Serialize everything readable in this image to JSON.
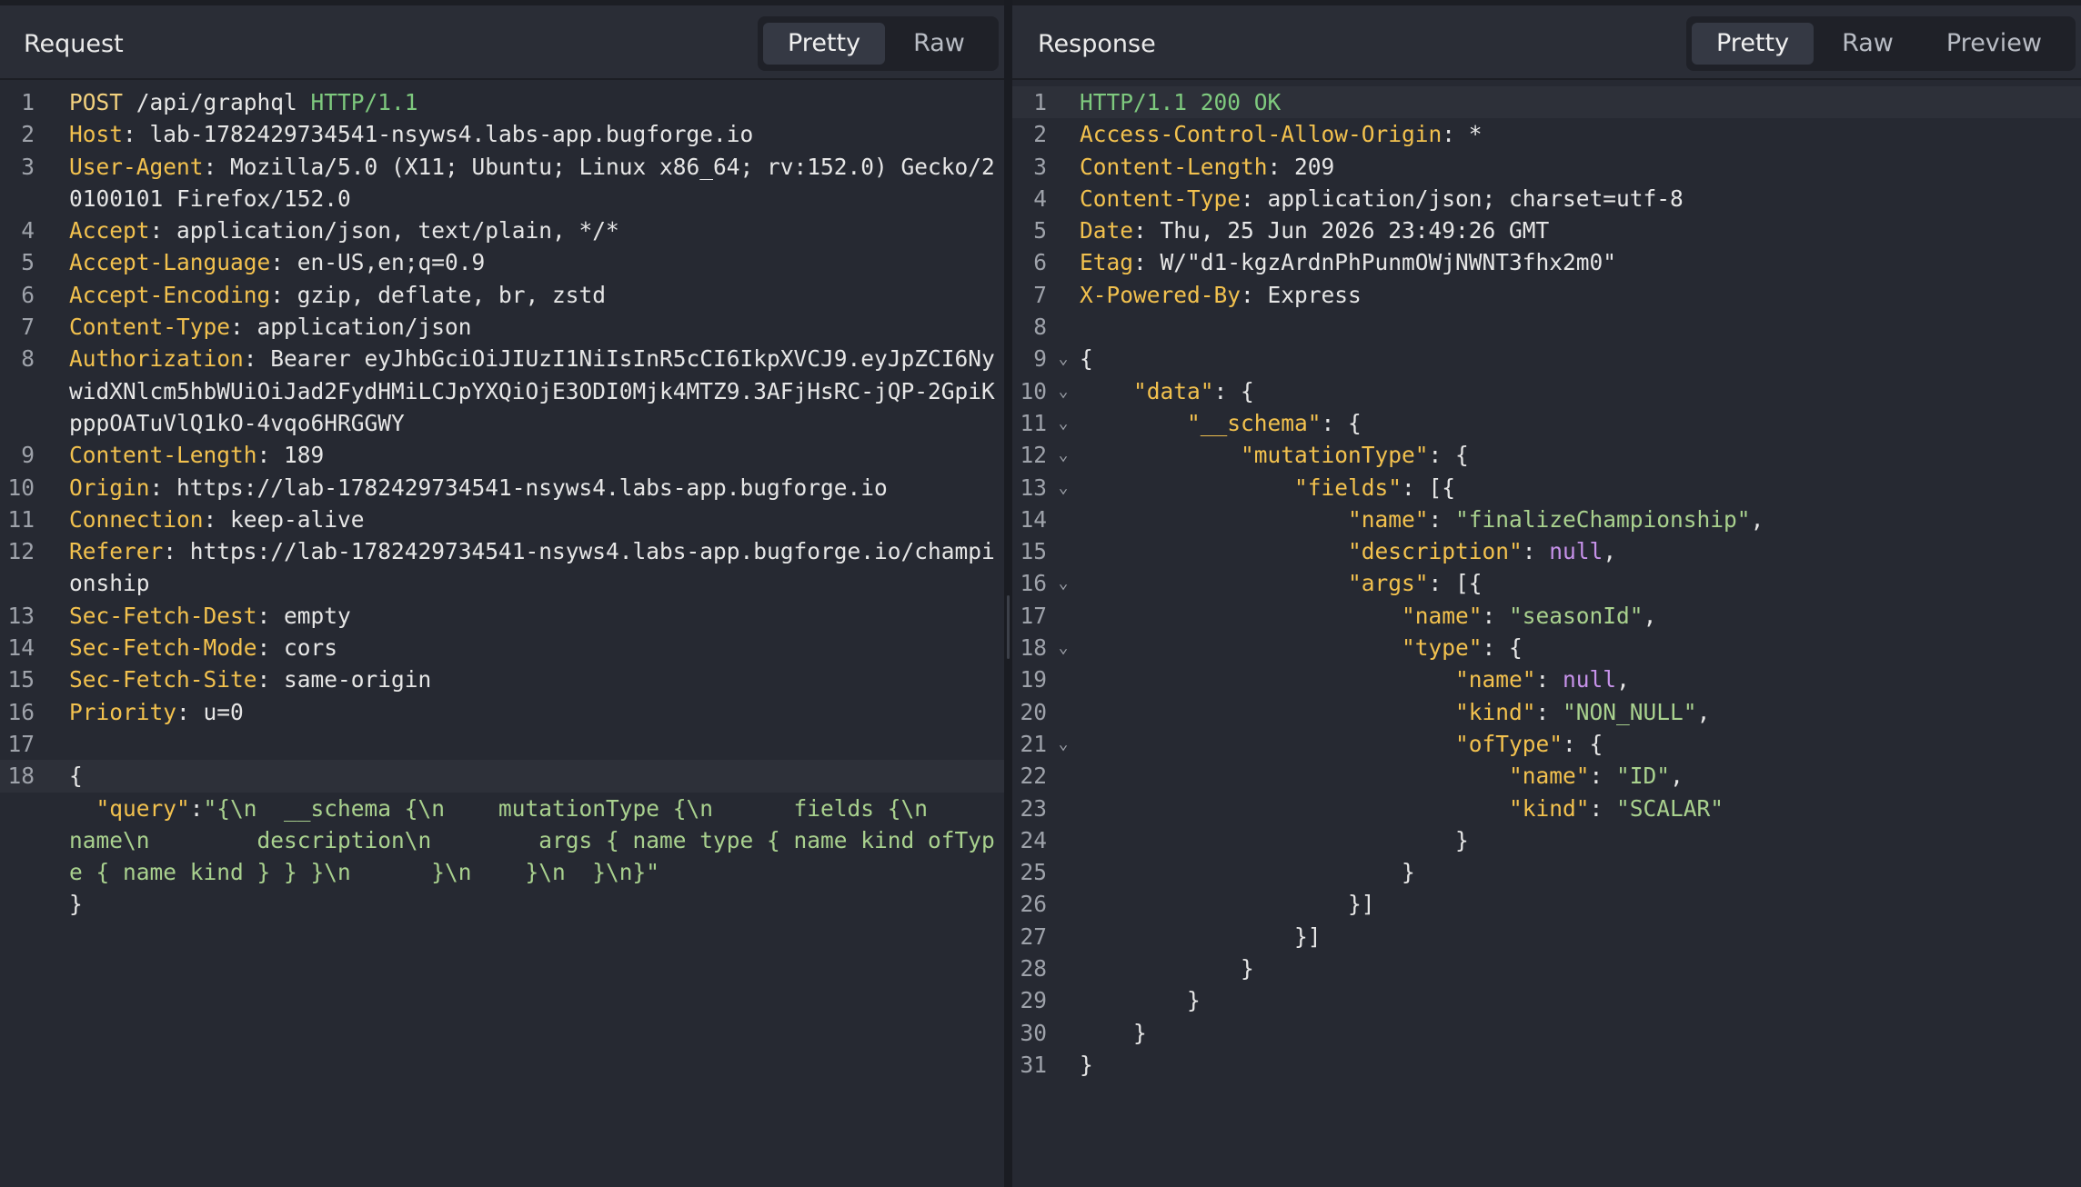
{
  "request": {
    "title": "Request",
    "tabs": [
      {
        "label": "Pretty",
        "active": true
      },
      {
        "label": "Raw",
        "active": false
      }
    ],
    "lines": [
      {
        "n": "1",
        "parts": [
          {
            "t": "POST",
            "c": "method"
          },
          {
            "t": " /api/graphql ",
            "c": "plain"
          },
          {
            "t": "HTTP/1.1",
            "c": "proto"
          }
        ]
      },
      {
        "n": "2",
        "parts": [
          {
            "t": "Host",
            "c": "hname"
          },
          {
            "t": ": lab-1782429734541-nsyws4.labs-app.bugforge.io",
            "c": "plain"
          }
        ]
      },
      {
        "n": "3",
        "parts": [
          {
            "t": "User-Agent",
            "c": "hname"
          },
          {
            "t": ": Mozilla/5.0 (X11; Ubuntu; Linux x86_64; rv:152.0) Gecko/20100101 Firefox/152.0",
            "c": "plain"
          }
        ]
      },
      {
        "n": "4",
        "parts": [
          {
            "t": "Accept",
            "c": "hname"
          },
          {
            "t": ": application/json, text/plain, */*",
            "c": "plain"
          }
        ]
      },
      {
        "n": "5",
        "parts": [
          {
            "t": "Accept-Language",
            "c": "hname"
          },
          {
            "t": ": en-US,en;q=0.9",
            "c": "plain"
          }
        ]
      },
      {
        "n": "6",
        "parts": [
          {
            "t": "Accept-Encoding",
            "c": "hname"
          },
          {
            "t": ": gzip, deflate, br, zstd",
            "c": "plain"
          }
        ]
      },
      {
        "n": "7",
        "parts": [
          {
            "t": "Content-Type",
            "c": "hname"
          },
          {
            "t": ": application/json",
            "c": "plain"
          }
        ]
      },
      {
        "n": "8",
        "parts": [
          {
            "t": "Authorization",
            "c": "hname"
          },
          {
            "t": ": Bearer eyJhbGciOiJIUzI1NiIsInR5cCI6IkpXVCJ9.eyJpZCI6NywidXNlcm5hbWUiOiJad2FydHMiLCJpYXQiOjE3ODI0Mjk4MTZ9.3AFjHsRC-jQP-2GpiKpppOATuVlQ1kO-4vqo6HRGGWY",
            "c": "plain"
          }
        ]
      },
      {
        "n": "9",
        "parts": [
          {
            "t": "Content-Length",
            "c": "hname"
          },
          {
            "t": ": 189",
            "c": "plain"
          }
        ]
      },
      {
        "n": "10",
        "parts": [
          {
            "t": "Origin",
            "c": "hname"
          },
          {
            "t": ": https://lab-1782429734541-nsyws4.labs-app.bugforge.io",
            "c": "plain"
          }
        ]
      },
      {
        "n": "11",
        "parts": [
          {
            "t": "Connection",
            "c": "hname"
          },
          {
            "t": ": keep-alive",
            "c": "plain"
          }
        ]
      },
      {
        "n": "12",
        "parts": [
          {
            "t": "Referer",
            "c": "hname"
          },
          {
            "t": ": https://lab-1782429734541-nsyws4.labs-app.bugforge.io/championship",
            "c": "plain"
          }
        ]
      },
      {
        "n": "13",
        "parts": [
          {
            "t": "Sec-Fetch-Dest",
            "c": "hname"
          },
          {
            "t": ": empty",
            "c": "plain"
          }
        ]
      },
      {
        "n": "14",
        "parts": [
          {
            "t": "Sec-Fetch-Mode",
            "c": "hname"
          },
          {
            "t": ": cors",
            "c": "plain"
          }
        ]
      },
      {
        "n": "15",
        "parts": [
          {
            "t": "Sec-Fetch-Site",
            "c": "hname"
          },
          {
            "t": ": same-origin",
            "c": "plain"
          }
        ]
      },
      {
        "n": "16",
        "parts": [
          {
            "t": "Priority",
            "c": "hname"
          },
          {
            "t": ": u=0",
            "c": "plain"
          }
        ]
      },
      {
        "n": "17",
        "parts": []
      },
      {
        "n": "18",
        "hl": true,
        "parts": [
          {
            "t": "{",
            "c": "plain"
          }
        ]
      },
      {
        "n": "",
        "parts": [
          {
            "t": "  ",
            "c": "plain"
          },
          {
            "t": "\"query\"",
            "c": "jkey"
          },
          {
            "t": ":",
            "c": "plain"
          },
          {
            "t": "\"{\\n  __schema {\\n    mutationType {\\n      fields {\\n        name\\n        description\\n        args { name type { name kind ofType { name kind } } }\\n      }\\n    }\\n  }\\n}\"",
            "c": "jstr"
          }
        ]
      },
      {
        "n": "",
        "parts": [
          {
            "t": "}",
            "c": "plain"
          }
        ]
      }
    ]
  },
  "response": {
    "title": "Response",
    "tabs": [
      {
        "label": "Pretty",
        "active": true
      },
      {
        "label": "Raw",
        "active": false
      },
      {
        "label": "Preview",
        "active": false
      }
    ],
    "lines": [
      {
        "n": "1",
        "hl": true,
        "parts": [
          {
            "t": "HTTP/1.1 200 OK",
            "c": "proto"
          }
        ]
      },
      {
        "n": "2",
        "parts": [
          {
            "t": "Access-Control-Allow-Origin",
            "c": "hname"
          },
          {
            "t": ": *",
            "c": "plain"
          }
        ]
      },
      {
        "n": "3",
        "parts": [
          {
            "t": "Content-Length",
            "c": "hname"
          },
          {
            "t": ": 209",
            "c": "plain"
          }
        ]
      },
      {
        "n": "4",
        "parts": [
          {
            "t": "Content-Type",
            "c": "hname"
          },
          {
            "t": ": application/json; charset=utf-8",
            "c": "plain"
          }
        ]
      },
      {
        "n": "5",
        "parts": [
          {
            "t": "Date",
            "c": "hname"
          },
          {
            "t": ": Thu, 25 Jun 2026 23:49:26 GMT",
            "c": "plain"
          }
        ]
      },
      {
        "n": "6",
        "parts": [
          {
            "t": "Etag",
            "c": "hname"
          },
          {
            "t": ": W/\"d1-kgzArdnPhPunmOWjNWNT3fhx2m0\"",
            "c": "plain"
          }
        ]
      },
      {
        "n": "7",
        "parts": [
          {
            "t": "X-Powered-By",
            "c": "hname"
          },
          {
            "t": ": Express",
            "c": "plain"
          }
        ]
      },
      {
        "n": "8",
        "parts": []
      },
      {
        "n": "9",
        "fold": true,
        "parts": [
          {
            "t": "{",
            "c": "plain"
          }
        ]
      },
      {
        "n": "10",
        "fold": true,
        "parts": [
          {
            "t": "    ",
            "c": "plain"
          },
          {
            "t": "\"data\"",
            "c": "jkey"
          },
          {
            "t": ": {",
            "c": "plain"
          }
        ]
      },
      {
        "n": "11",
        "fold": true,
        "parts": [
          {
            "t": "        ",
            "c": "plain"
          },
          {
            "t": "\"__schema\"",
            "c": "jkey"
          },
          {
            "t": ": {",
            "c": "plain"
          }
        ]
      },
      {
        "n": "12",
        "fold": true,
        "parts": [
          {
            "t": "            ",
            "c": "plain"
          },
          {
            "t": "\"mutationType\"",
            "c": "jkey"
          },
          {
            "t": ": {",
            "c": "plain"
          }
        ]
      },
      {
        "n": "13",
        "fold": true,
        "parts": [
          {
            "t": "                ",
            "c": "plain"
          },
          {
            "t": "\"fields\"",
            "c": "jkey"
          },
          {
            "t": ": [{",
            "c": "plain"
          }
        ]
      },
      {
        "n": "14",
        "parts": [
          {
            "t": "                    ",
            "c": "plain"
          },
          {
            "t": "\"name\"",
            "c": "jkey"
          },
          {
            "t": ": ",
            "c": "plain"
          },
          {
            "t": "\"finalizeChampionship\"",
            "c": "jstr"
          },
          {
            "t": ",",
            "c": "plain"
          }
        ]
      },
      {
        "n": "15",
        "parts": [
          {
            "t": "                    ",
            "c": "plain"
          },
          {
            "t": "\"description\"",
            "c": "jkey"
          },
          {
            "t": ": ",
            "c": "plain"
          },
          {
            "t": "null",
            "c": "jnull"
          },
          {
            "t": ",",
            "c": "plain"
          }
        ]
      },
      {
        "n": "16",
        "fold": true,
        "parts": [
          {
            "t": "                    ",
            "c": "plain"
          },
          {
            "t": "\"args\"",
            "c": "jkey"
          },
          {
            "t": ": [{",
            "c": "plain"
          }
        ]
      },
      {
        "n": "17",
        "parts": [
          {
            "t": "                        ",
            "c": "plain"
          },
          {
            "t": "\"name\"",
            "c": "jkey"
          },
          {
            "t": ": ",
            "c": "plain"
          },
          {
            "t": "\"seasonId\"",
            "c": "jstr"
          },
          {
            "t": ",",
            "c": "plain"
          }
        ]
      },
      {
        "n": "18",
        "fold": true,
        "parts": [
          {
            "t": "                        ",
            "c": "plain"
          },
          {
            "t": "\"type\"",
            "c": "jkey"
          },
          {
            "t": ": {",
            "c": "plain"
          }
        ]
      },
      {
        "n": "19",
        "parts": [
          {
            "t": "                            ",
            "c": "plain"
          },
          {
            "t": "\"name\"",
            "c": "jkey"
          },
          {
            "t": ": ",
            "c": "plain"
          },
          {
            "t": "null",
            "c": "jnull"
          },
          {
            "t": ",",
            "c": "plain"
          }
        ]
      },
      {
        "n": "20",
        "parts": [
          {
            "t": "                            ",
            "c": "plain"
          },
          {
            "t": "\"kind\"",
            "c": "jkey"
          },
          {
            "t": ": ",
            "c": "plain"
          },
          {
            "t": "\"NON_NULL\"",
            "c": "jstr"
          },
          {
            "t": ",",
            "c": "plain"
          }
        ]
      },
      {
        "n": "21",
        "fold": true,
        "parts": [
          {
            "t": "                            ",
            "c": "plain"
          },
          {
            "t": "\"ofType\"",
            "c": "jkey"
          },
          {
            "t": ": {",
            "c": "plain"
          }
        ]
      },
      {
        "n": "22",
        "parts": [
          {
            "t": "                                ",
            "c": "plain"
          },
          {
            "t": "\"name\"",
            "c": "jkey"
          },
          {
            "t": ": ",
            "c": "plain"
          },
          {
            "t": "\"ID\"",
            "c": "jstr"
          },
          {
            "t": ",",
            "c": "plain"
          }
        ]
      },
      {
        "n": "23",
        "parts": [
          {
            "t": "                                ",
            "c": "plain"
          },
          {
            "t": "\"kind\"",
            "c": "jkey"
          },
          {
            "t": ": ",
            "c": "plain"
          },
          {
            "t": "\"SCALAR\"",
            "c": "jstr"
          }
        ]
      },
      {
        "n": "24",
        "parts": [
          {
            "t": "                            }",
            "c": "plain"
          }
        ]
      },
      {
        "n": "25",
        "parts": [
          {
            "t": "                        }",
            "c": "plain"
          }
        ]
      },
      {
        "n": "26",
        "parts": [
          {
            "t": "                    }]",
            "c": "plain"
          }
        ]
      },
      {
        "n": "27",
        "parts": [
          {
            "t": "                }]",
            "c": "plain"
          }
        ]
      },
      {
        "n": "28",
        "parts": [
          {
            "t": "            }",
            "c": "plain"
          }
        ]
      },
      {
        "n": "29",
        "parts": [
          {
            "t": "        }",
            "c": "plain"
          }
        ]
      },
      {
        "n": "30",
        "parts": [
          {
            "t": "    }",
            "c": "plain"
          }
        ]
      },
      {
        "n": "31",
        "parts": [
          {
            "t": "}",
            "c": "plain"
          }
        ]
      }
    ]
  },
  "icons": {
    "fold": "chevron-down-icon"
  }
}
